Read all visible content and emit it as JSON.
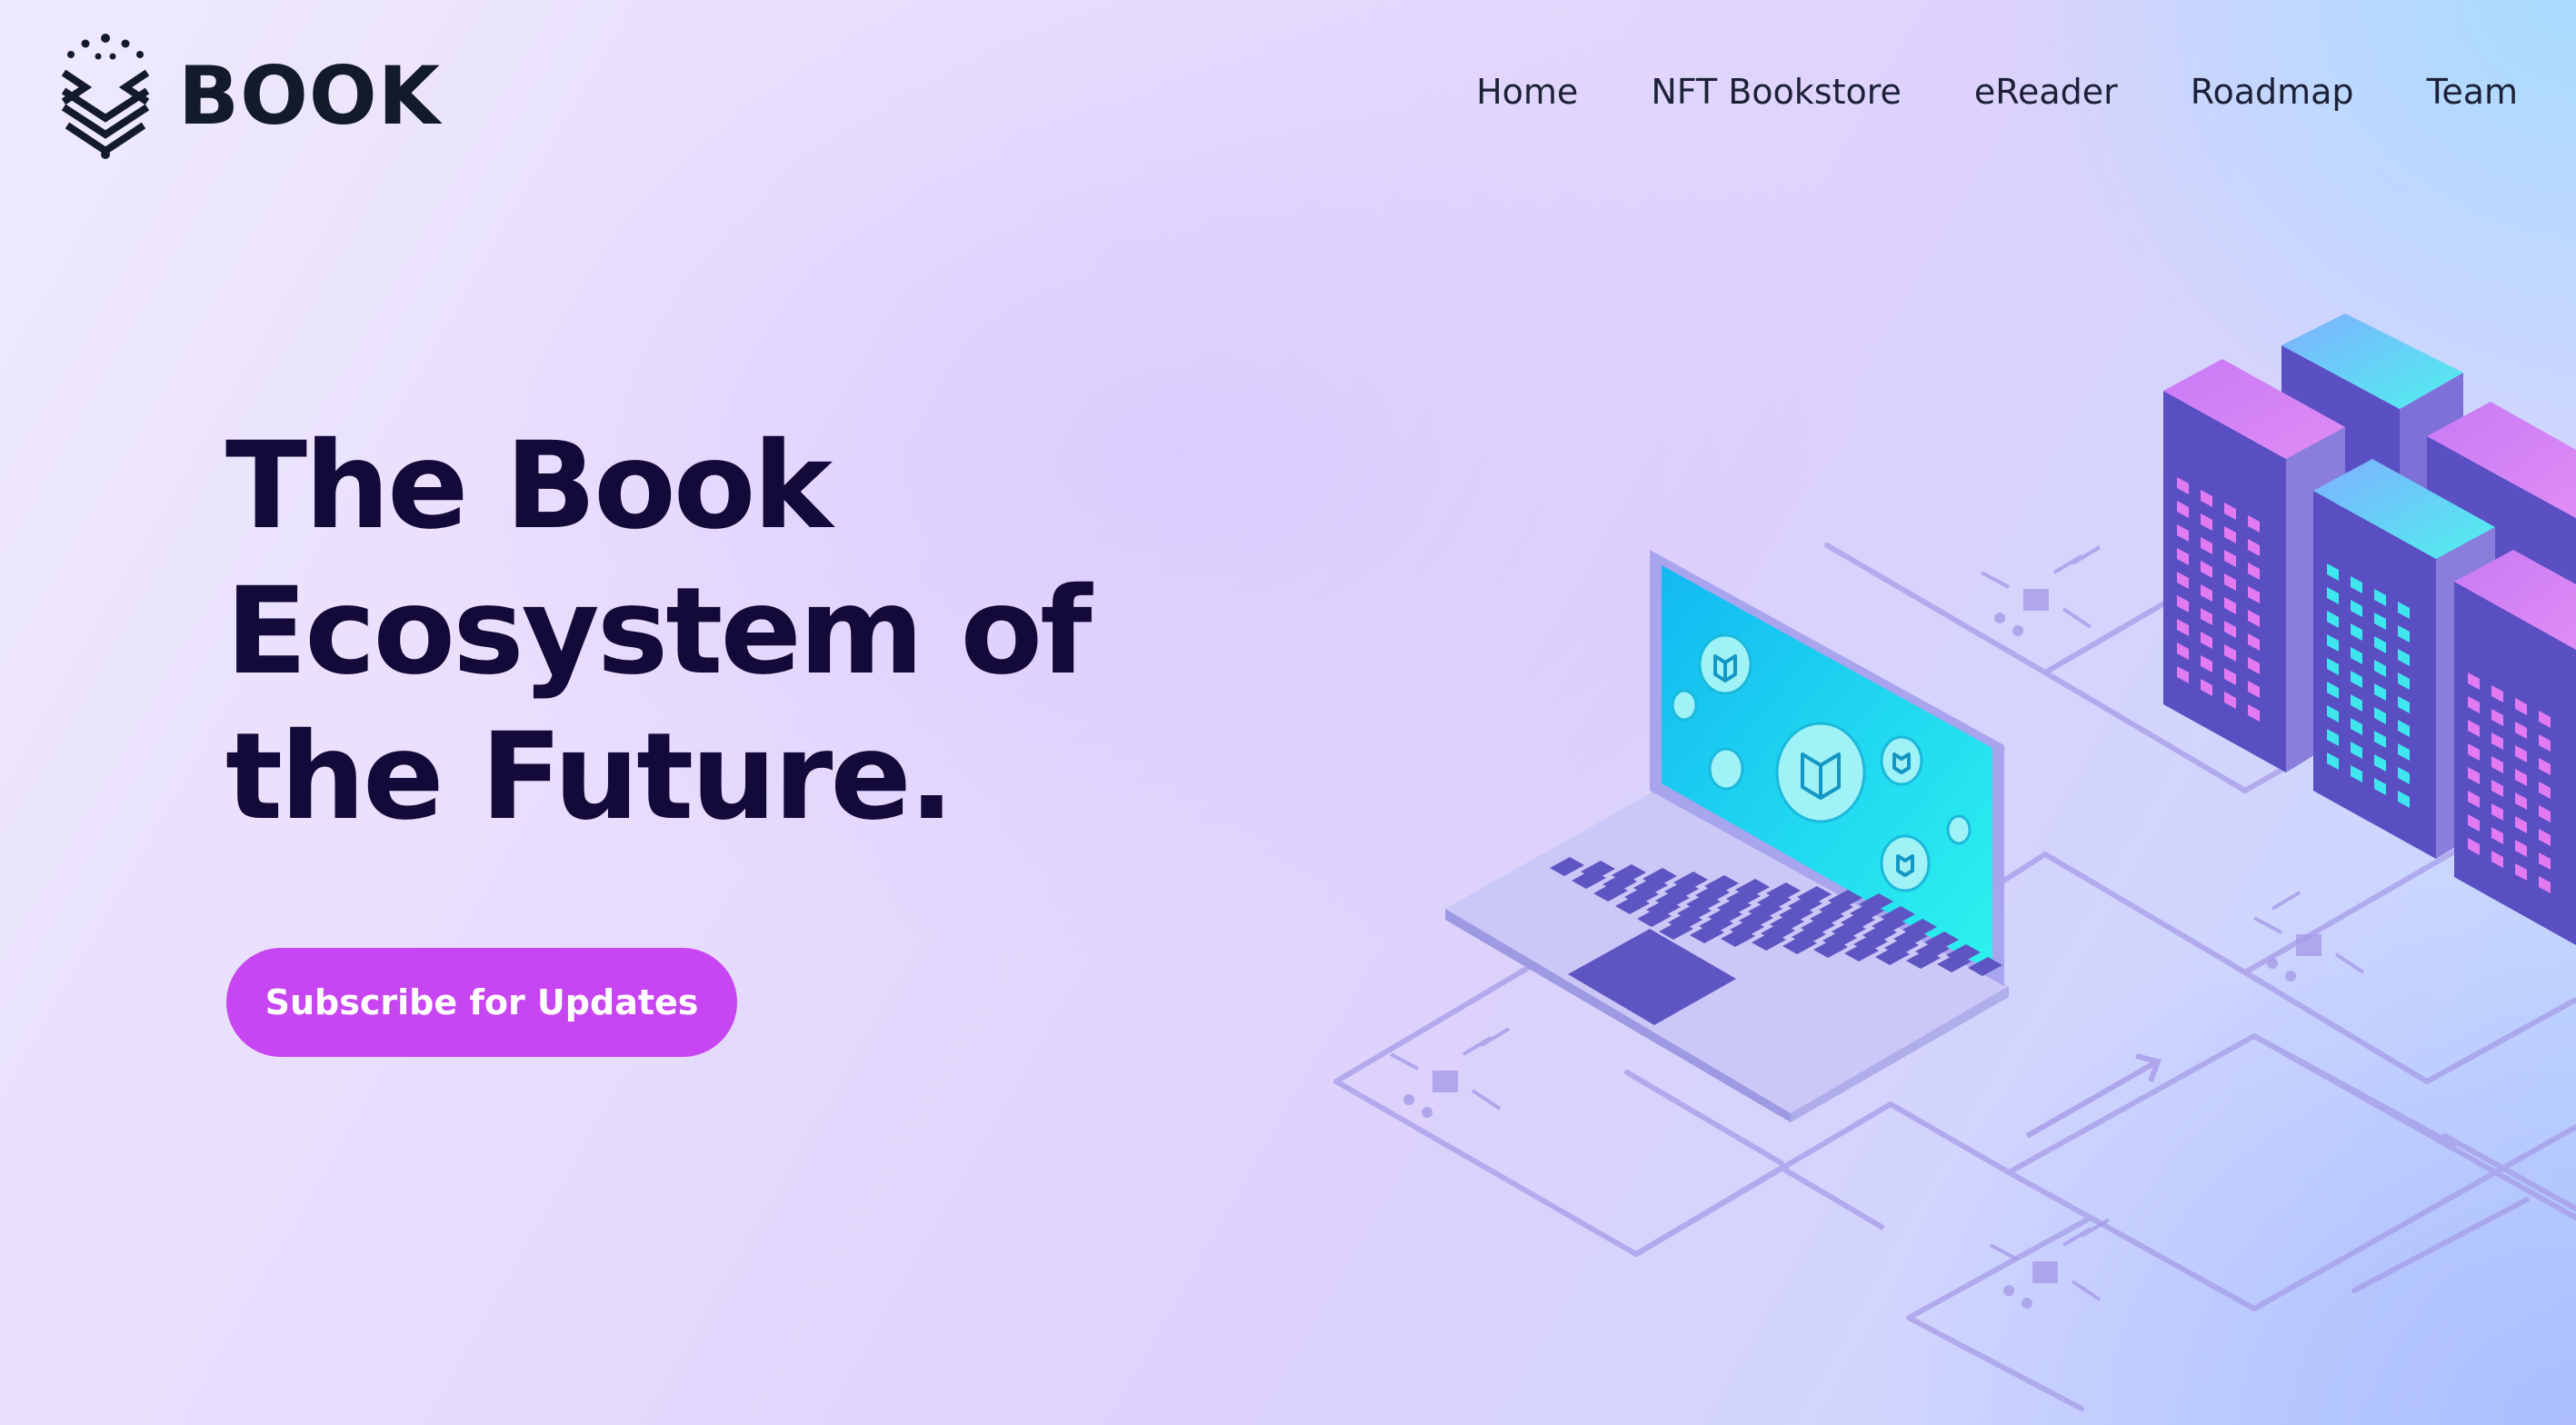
{
  "brand": {
    "name": "BOOK",
    "logo_icon": "book-chevron-logo"
  },
  "nav": {
    "items": [
      {
        "label": "Home"
      },
      {
        "label": "NFT Bookstore"
      },
      {
        "label": "eReader"
      },
      {
        "label": "Roadmap"
      },
      {
        "label": "Team"
      }
    ]
  },
  "hero": {
    "title_lines": [
      "The Book",
      "Ecosystem of",
      "the Future."
    ],
    "cta_label": "Subscribe for Updates"
  },
  "colors": {
    "accent": "#c846f2",
    "heading": "#130a3a",
    "screen": "#1fd6f0"
  },
  "illustration": {
    "description_icon": "isometric-laptop-and-buildings-illustration",
    "icons": [
      "book-icon",
      "laptop-icon",
      "building-icon"
    ]
  }
}
